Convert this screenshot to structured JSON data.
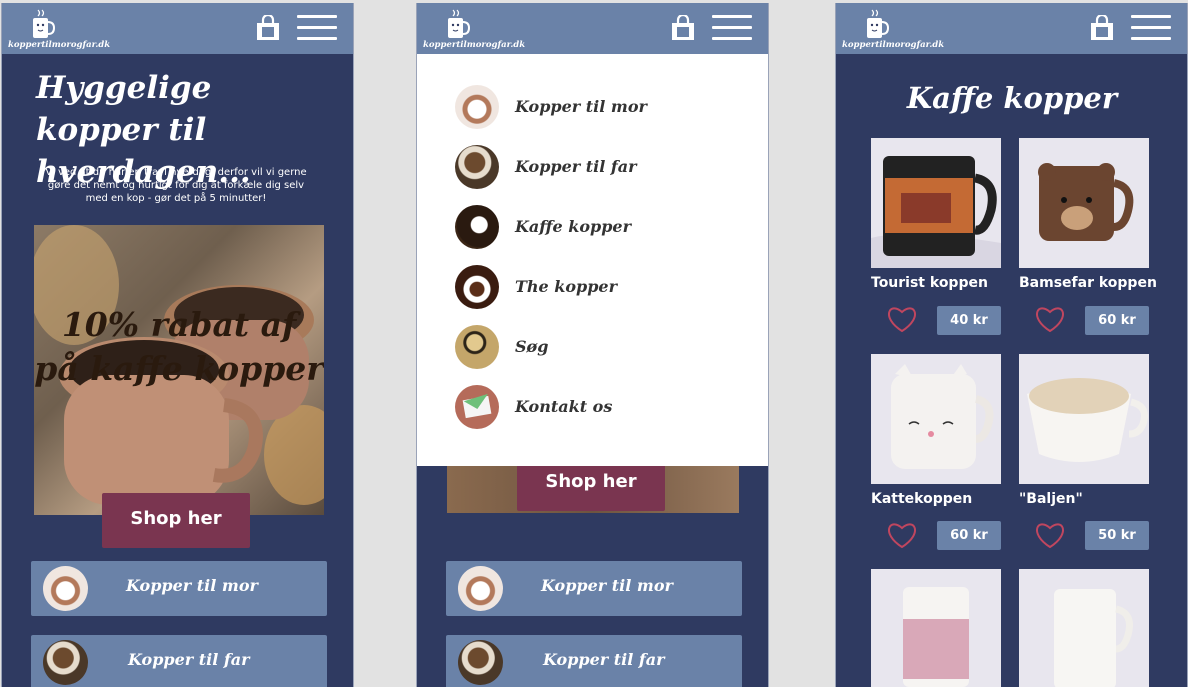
{
  "brand": {
    "logo_text": "koppertilmorogfar.dk"
  },
  "colors": {
    "navy": "#2f3a61",
    "bar": "#6a82a8",
    "accent": "#7a3550",
    "heart": "#c0465f"
  },
  "icons": {
    "cart": "shopping-bag-icon",
    "menu": "hamburger-menu-icon",
    "wishlist": "heart-icon"
  },
  "home": {
    "title": "Hyggelige kopper til hverdagen...",
    "subtitle": "Vi ved at du har en travl hverdag, derfor vil vi gerne gøre det nemt og hurtigt for dig at forkæle dig selv med en kop - gør det på 5 minutter!",
    "promo_text": "10% rabat af på kaffe kopper",
    "shop_button": "Shop her",
    "categories": [
      "Kopper til mor",
      "Kopper til far"
    ]
  },
  "menu": {
    "items": [
      "Kopper til mor",
      "Kopper til far",
      "Kaffe kopper",
      "The kopper",
      "Søg",
      "Kontakt os"
    ],
    "shop_button": "Shop her",
    "categories": [
      "Kopper til mor",
      "Kopper til far"
    ]
  },
  "category_page": {
    "title": "Kaffe kopper",
    "products": [
      {
        "name": "Tourist koppen",
        "price": "40 kr"
      },
      {
        "name": "Bamsefar koppen",
        "price": "60 kr"
      },
      {
        "name": "Kattekoppen",
        "price": "60 kr"
      },
      {
        "name": "\"Baljen\"",
        "price": "50 kr"
      },
      {
        "name": "",
        "price": ""
      },
      {
        "name": "",
        "price": ""
      }
    ]
  }
}
